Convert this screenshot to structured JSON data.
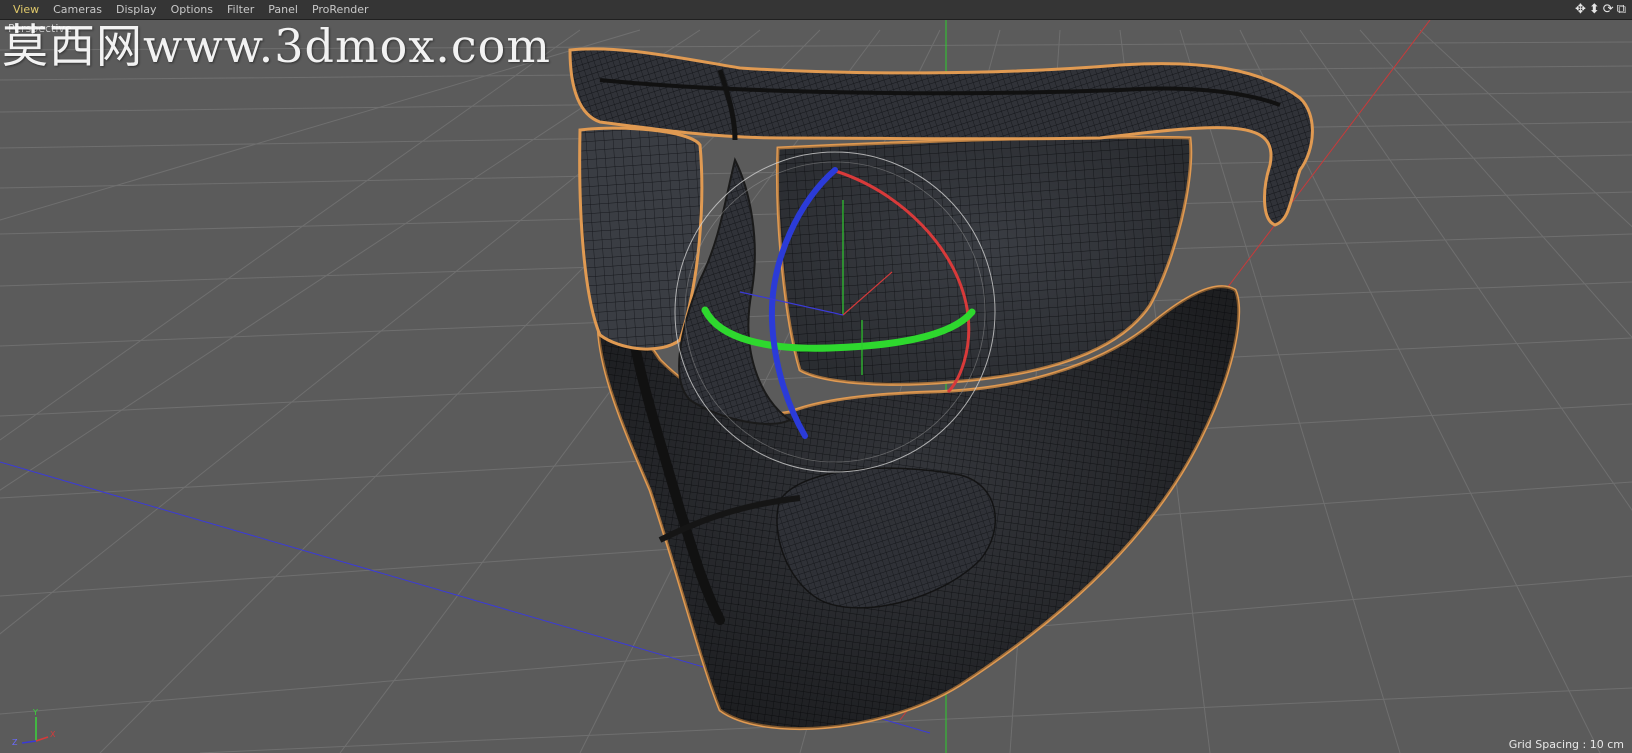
{
  "menubar": {
    "items": [
      "View",
      "Cameras",
      "Display",
      "Options",
      "Filter",
      "Panel",
      "ProRender"
    ]
  },
  "viewport": {
    "label": "Perspective"
  },
  "watermark": {
    "text": "莫西网www.3dmox.com"
  },
  "nav_icons": {
    "move": "✥",
    "dolly": "⬍",
    "rotate": "⟳",
    "maximize": "⧉"
  },
  "axis_gizmo": {
    "x_label": "X",
    "y_label": "Y",
    "z_label": "Z"
  },
  "status": {
    "grid_spacing": "Grid Spacing : 10 cm"
  },
  "colors": {
    "background": "#5b5b5b",
    "grid": "#6e6e6e",
    "mesh_fill": "#2f3136",
    "mesh_wire": "#1a1a1a",
    "selection_outline": "#e8a25a",
    "axis_x": "#d63a3a",
    "axis_y": "#3ad63a",
    "axis_z": "#3a3ad6",
    "rotate_ring_x": "#d83a3a",
    "rotate_ring_y": "#2ed82e",
    "rotate_ring_z": "#2b3bd8"
  }
}
